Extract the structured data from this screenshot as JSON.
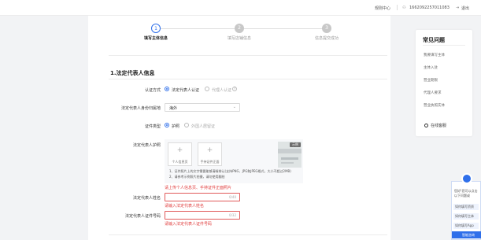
{
  "topbar": {
    "help_center": "规则中心",
    "phone": "1662092257011083",
    "logout": "退出"
  },
  "steps": [
    {
      "number": "1",
      "label": "填写主体信息",
      "state": "active"
    },
    {
      "number": "2",
      "label": "填写店铺信息",
      "state": "inactive"
    },
    {
      "number": "3",
      "label": "信息提交成功",
      "state": "inactive"
    }
  ],
  "section_title": "1.法定代表人信息",
  "auth_method": {
    "label": "认证方式",
    "option_1": "法定代表人认证",
    "option_2": "代理人认证",
    "selected": "法定代表人认证"
  },
  "region": {
    "label": "法定代表人身份归属地",
    "value": "海外"
  },
  "doc_type": {
    "label": "证件类型",
    "option_1": "护照",
    "option_2": "外国人居留证",
    "selected": "护照"
  },
  "passport": {
    "label": "法定代表人护照",
    "upload_1": "个人信息页",
    "upload_2": "手持证件正面",
    "sample_tag": "示例",
    "note_1": "1、证件照片上的文字需要能够清晰辨认(支持PNG、JPG和JPEG格式，大小不超过2MB)",
    "note_2": "2、请参考示例照片拍摄，请勿使用翻拍",
    "error": "请上传个人信息页、手持证件正面照片"
  },
  "name_field": {
    "label": "法定代表人姓名",
    "counter": "0/40",
    "error": "请输入法定代表人姓名"
  },
  "id_field": {
    "label": "法定代表人证件号码",
    "counter": "0/32",
    "error": "请输入法定代表人证件号码"
  },
  "faq": {
    "title": "常见问题",
    "items": [
      "我要填写主体",
      "主体入驻",
      "营业期限",
      "代理人要求",
      "营业执照实体"
    ],
    "consult": "在线客服"
  },
  "chat": {
    "intro_1": "您好!您可以点击",
    "intro_2": "以下问题或",
    "q1": "如何填写资质",
    "q2": "如何填写主体",
    "q3": "如何填写App",
    "button": "智能咨询"
  },
  "colors": {
    "accent": "#2f6fea",
    "error": "#e03a3a"
  }
}
